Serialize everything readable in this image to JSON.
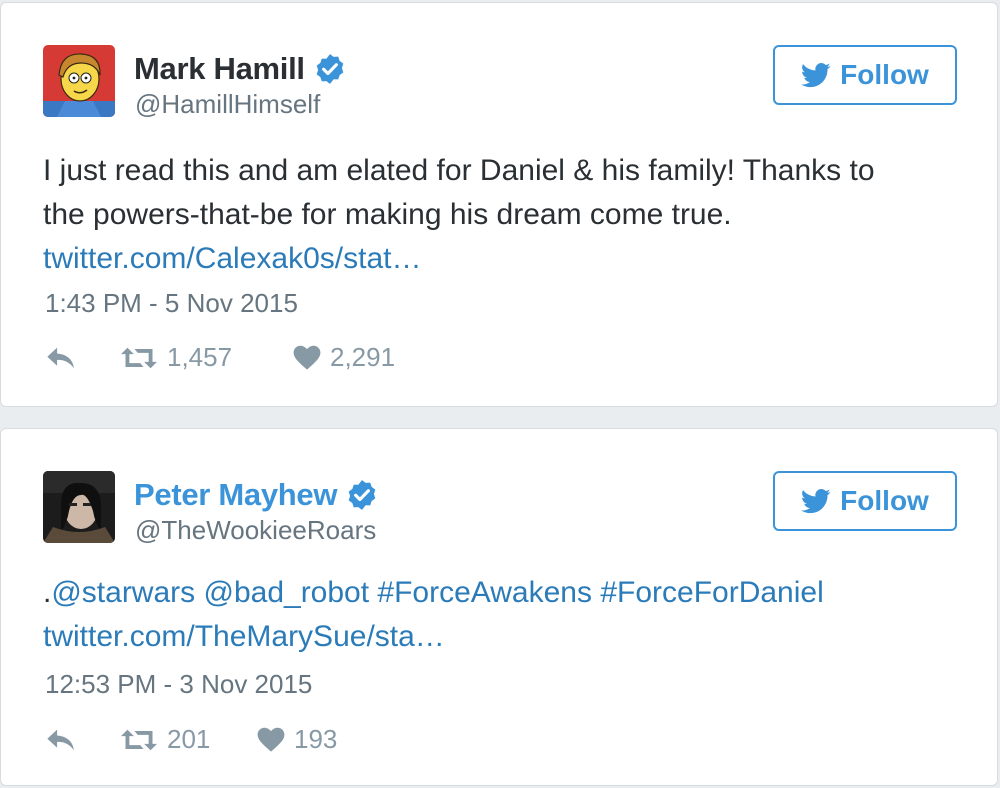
{
  "tweets": [
    {
      "name": "Mark Hamill",
      "handle": "@HamillHimself",
      "follow_label": "Follow",
      "text_line1": "I just read this and am elated for Daniel & his family! Thanks to",
      "text_line2": "the powers-that-be for making his dream come true.",
      "link": "twitter.com/Calexak0s/stat…",
      "timestamp": "1:43 PM - 5 Nov 2015",
      "retweets": "1,457",
      "likes": "2,291",
      "avatar_icon": "simpsons-cartoon-avatar"
    },
    {
      "name": "Peter Mayhew",
      "handle": "@TheWookieeRoars",
      "follow_label": "Follow",
      "text_prefix": ".",
      "mentions": [
        "@starwars",
        "@bad_robot"
      ],
      "hashtags": [
        "#ForceAwakens",
        "#ForceForDaniel"
      ],
      "link": "twitter.com/TheMarySue/sta…",
      "timestamp": "12:53 PM - 3 Nov 2015",
      "retweets": "201",
      "likes": "193",
      "avatar_icon": "photo-avatar"
    }
  ],
  "colors": {
    "link": "#2b7bb9",
    "accent": "#3b94d9",
    "muted": "#66757f",
    "icon": "#8899a6"
  }
}
